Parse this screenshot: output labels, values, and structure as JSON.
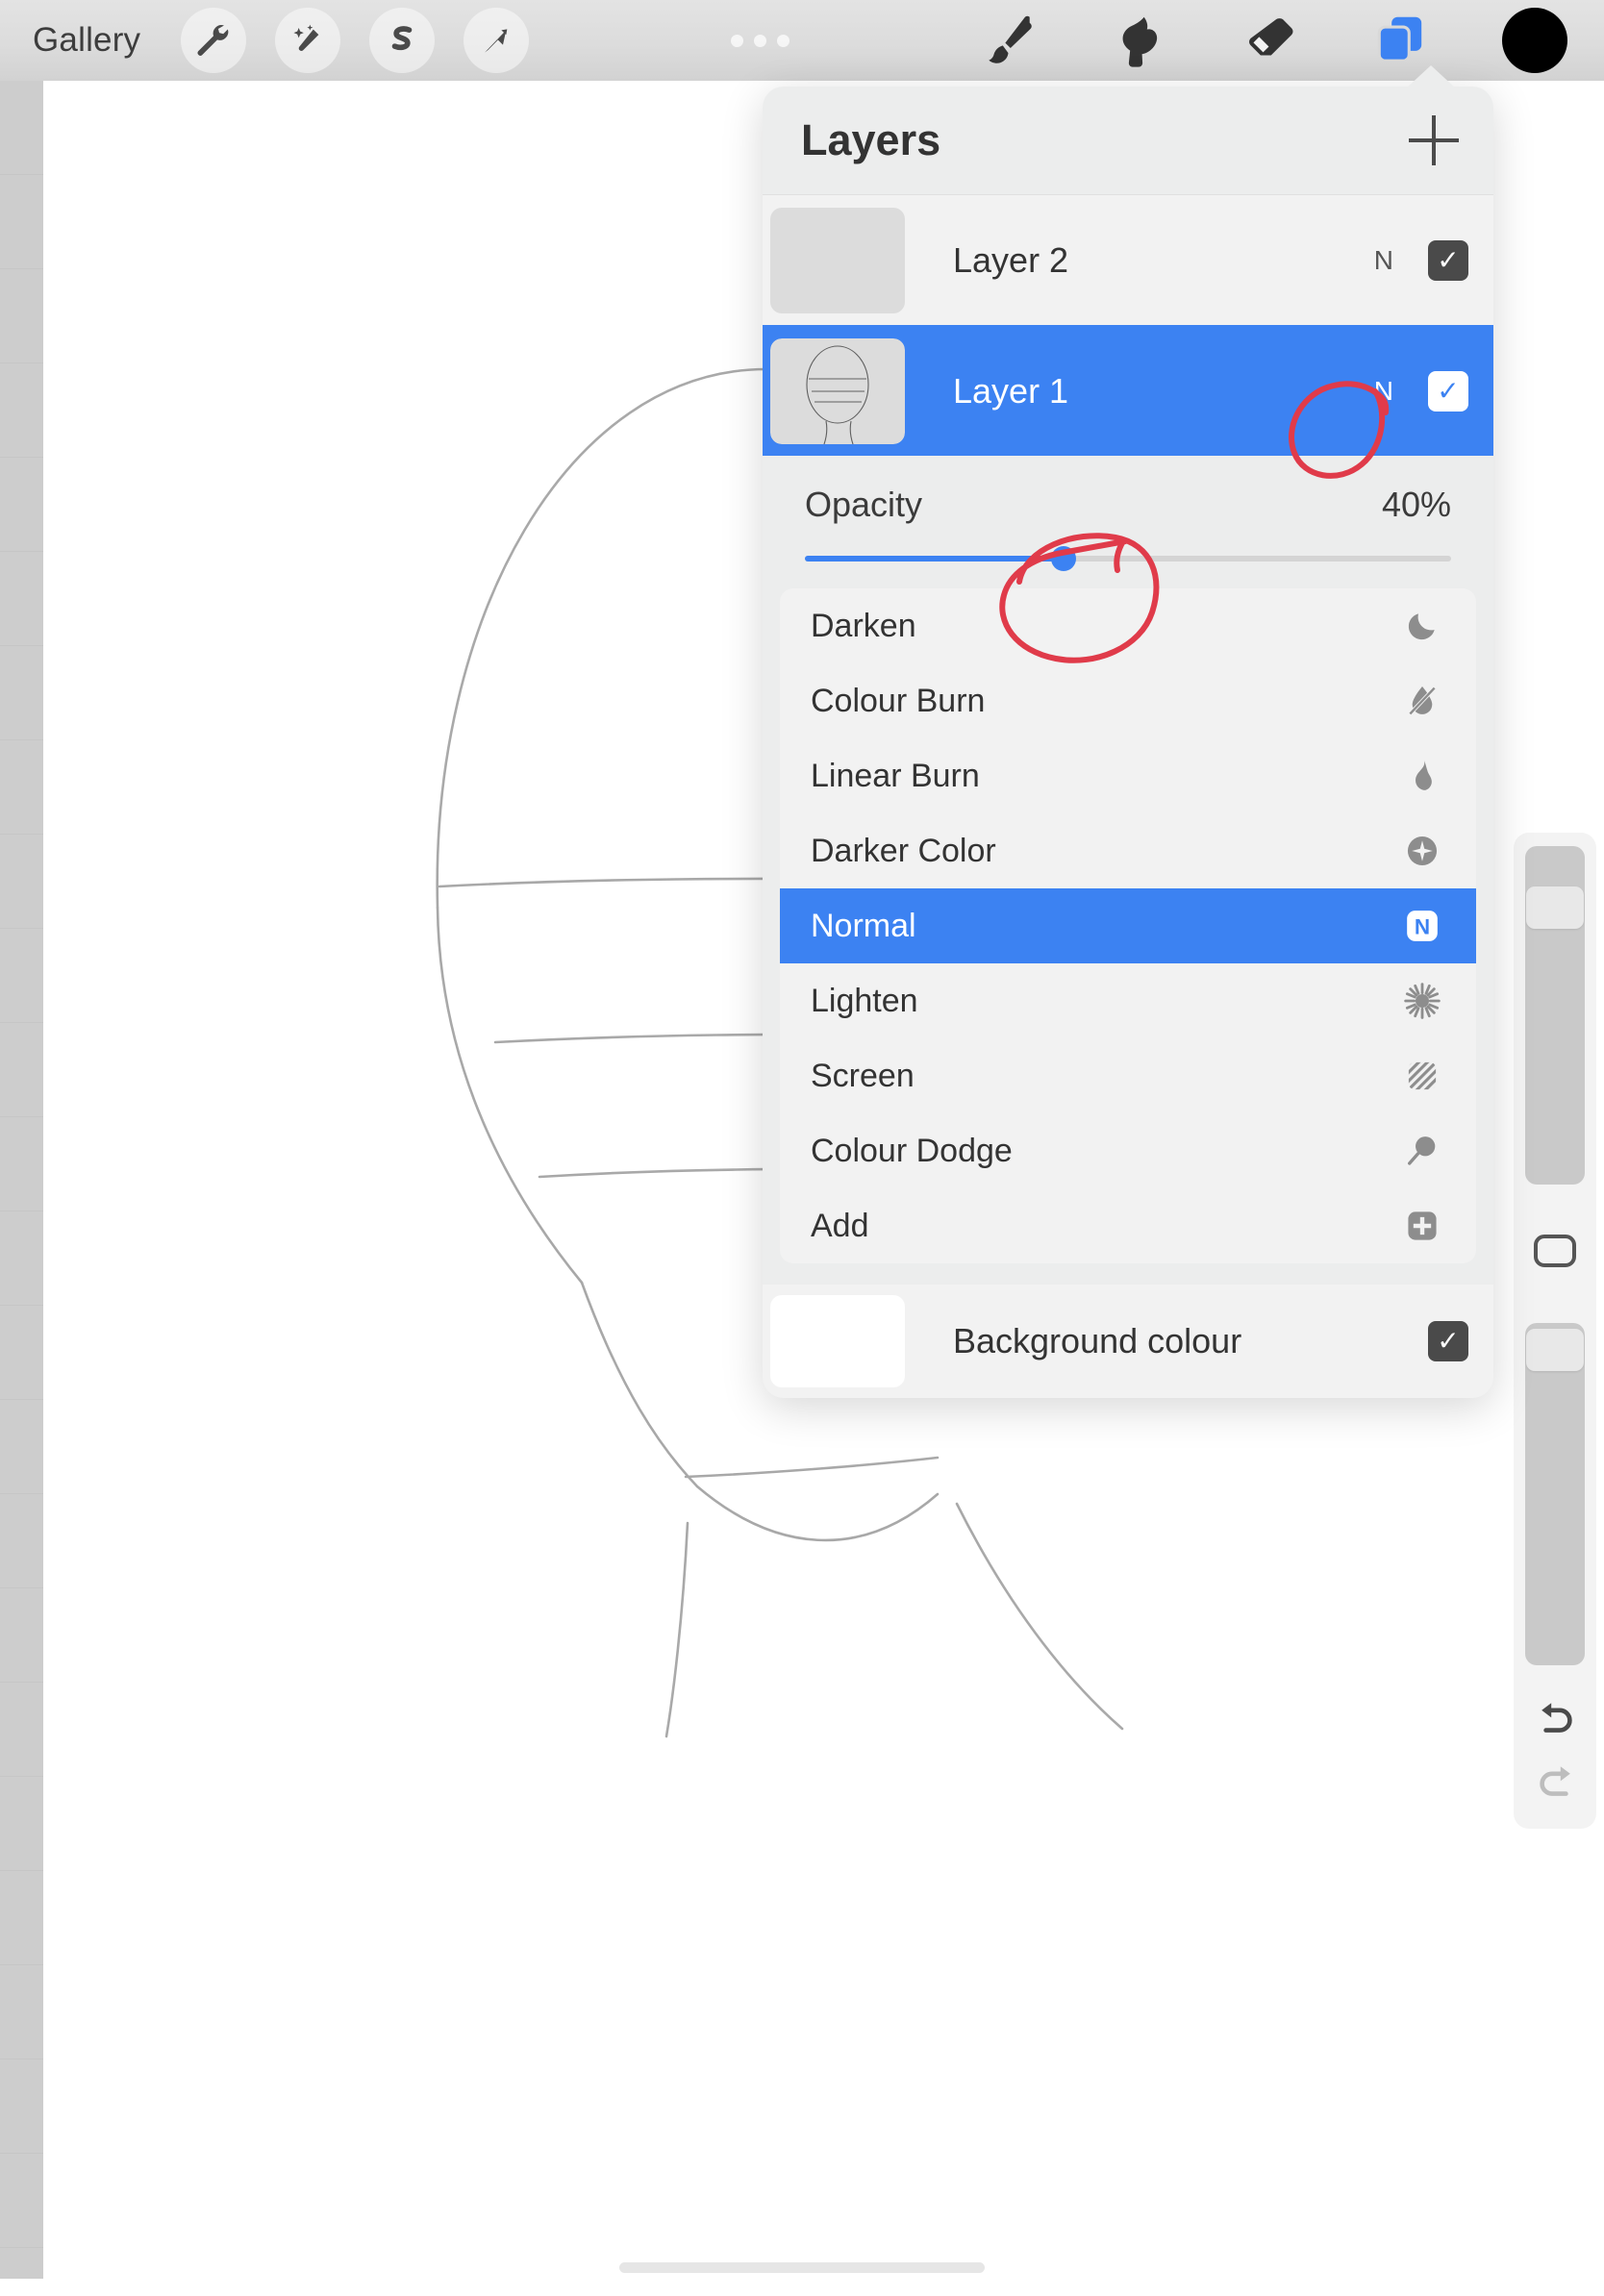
{
  "toolbar": {
    "gallery_label": "Gallery",
    "left_tools": [
      {
        "name": "actions-wrench",
        "icon": "wrench-icon"
      },
      {
        "name": "adjustments",
        "icon": "magic-wand-icon"
      },
      {
        "name": "selection",
        "icon": "s-curve-icon"
      },
      {
        "name": "transform",
        "icon": "arrow-pointer-icon"
      }
    ],
    "dots": "three-dots-icon",
    "right_tools": [
      {
        "name": "paint",
        "icon": "paintbrush-icon",
        "active": false
      },
      {
        "name": "smudge",
        "icon": "smudge-finger-icon",
        "active": false
      },
      {
        "name": "erase",
        "icon": "eraser-icon",
        "active": false
      },
      {
        "name": "layers",
        "icon": "layers-stack-icon",
        "active": true
      }
    ],
    "color_swatch": "#000000"
  },
  "panel": {
    "title": "Layers",
    "add_label": "+",
    "layers": [
      {
        "name": "Layer 2",
        "mode": "N",
        "visible": true,
        "selected": false,
        "check": "✓",
        "has_thumb_art": false
      },
      {
        "name": "Layer 1",
        "mode": "N",
        "visible": true,
        "selected": true,
        "check": "✓",
        "has_thumb_art": true
      }
    ],
    "opacity": {
      "label": "Opacity",
      "value": "40%",
      "percent": 40
    },
    "blend_modes": [
      {
        "label": "Darken",
        "icon": "moon-icon",
        "active": false
      },
      {
        "label": "Colour Burn",
        "icon": "droplet-slash-icon",
        "active": false
      },
      {
        "label": "Linear Burn",
        "icon": "flame-icon",
        "active": false
      },
      {
        "label": "Darker Color",
        "icon": "plus-circle-icon",
        "active": false
      },
      {
        "label": "Normal",
        "icon": "n-badge-icon",
        "active": true
      },
      {
        "label": "Lighten",
        "icon": "starburst-icon",
        "active": false
      },
      {
        "label": "Screen",
        "icon": "hatched-square-icon",
        "active": false
      },
      {
        "label": "Colour Dodge",
        "icon": "magnifier-icon",
        "active": false
      },
      {
        "label": "Add",
        "icon": "plus-square-icon",
        "active": false
      }
    ],
    "background": {
      "label": "Background colour",
      "swatch": "#ffffff",
      "visible": true,
      "check": "✓"
    }
  },
  "sidebar": {
    "brush_size_percent": 88,
    "brush_opacity_percent": 92,
    "modify_button": "square-modify-button",
    "undo": "undo-arrow-icon",
    "redo": "redo-arrow-icon"
  },
  "annotations": [
    {
      "name": "circle-around-blend-mode-n",
      "color": "#e03b4a"
    },
    {
      "name": "circle-around-opacity-slider",
      "color": "#e03b4a"
    }
  ],
  "colors": {
    "accent_blue": "#3c82f2",
    "panel_bg": "#eceded",
    "row_bg": "#f2f2f2",
    "annotation_red": "#e03b4a"
  }
}
